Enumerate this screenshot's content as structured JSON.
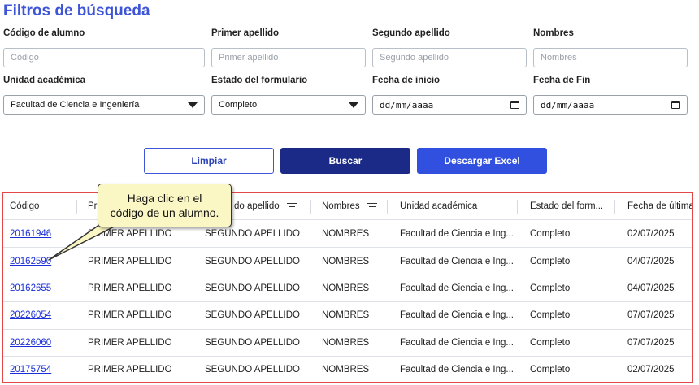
{
  "page_title": "Filtros de búsqueda",
  "filters": {
    "codigo": {
      "label": "Código de alumno",
      "placeholder": "Código"
    },
    "primer_apellido": {
      "label": "Primer apellido",
      "placeholder": "Primer apellido"
    },
    "segundo_apellido": {
      "label": "Segundo apellido",
      "placeholder": "Segundo apellido"
    },
    "nombres": {
      "label": "Nombres",
      "placeholder": "Nombres"
    },
    "unidad": {
      "label": "Unidad académica",
      "value": "Facultad de Ciencia e Ingeniería"
    },
    "estado": {
      "label": "Estado del formulario",
      "value": "Completo"
    },
    "fecha_inicio": {
      "label": "Fecha de inicio",
      "value": "dd/mm/aaaa"
    },
    "fecha_fin": {
      "label": "Fecha de Fin",
      "value": "dd/mm/aaaa"
    }
  },
  "buttons": {
    "clear": "Limpiar",
    "search": "Buscar",
    "excel": "Descargar Excel"
  },
  "table": {
    "headers": [
      "Código",
      "Pri",
      "do apellido",
      "Nombres",
      "Unidad académica",
      "Estado del form...",
      "Fecha de última"
    ],
    "rows": [
      [
        "20161946",
        "PRIMER APELLIDO",
        "SEGUNDO APELLIDO",
        "NOMBRES",
        "Facultad de Ciencia e Ing...",
        "Completo",
        "02/07/2025"
      ],
      [
        "20162590",
        "PRIMER APELLIDO",
        "SEGUNDO APELLIDO",
        "NOMBRES",
        "Facultad de Ciencia e Ing...",
        "Completo",
        "04/07/2025"
      ],
      [
        "20162655",
        "PRIMER APELLIDO",
        "SEGUNDO APELLIDO",
        "NOMBRES",
        "Facultad de Ciencia e Ing...",
        "Completo",
        "04/07/2025"
      ],
      [
        "20226054",
        "PRIMER APELLIDO",
        "SEGUNDO APELLIDO",
        "NOMBRES",
        "Facultad de Ciencia e Ing...",
        "Completo",
        "07/07/2025"
      ],
      [
        "20226060",
        "PRIMER APELLIDO",
        "SEGUNDO APELLIDO",
        "NOMBRES",
        "Facultad de Ciencia e Ing...",
        "Completo",
        "07/07/2025"
      ],
      [
        "20175754",
        "PRIMER APELLIDO",
        "SEGUNDO APELLIDO",
        "NOMBRES",
        "Facultad de Ciencia e Ing...",
        "Completo",
        "02/07/2025"
      ]
    ]
  },
  "tooltip": {
    "line1": "Haga clic en el",
    "line2": "código de un alumno."
  },
  "colors": {
    "accent": "#3d55d6",
    "search_button": "#1a2a86",
    "excel_button": "#3150e0",
    "highlight_border": "#e34848",
    "tooltip_bg": "#fbf7c4"
  },
  "icons": {
    "select_arrow": "triangle-down-icon",
    "date_picker": "calendar-icon",
    "column_filter": "filter-icon"
  }
}
